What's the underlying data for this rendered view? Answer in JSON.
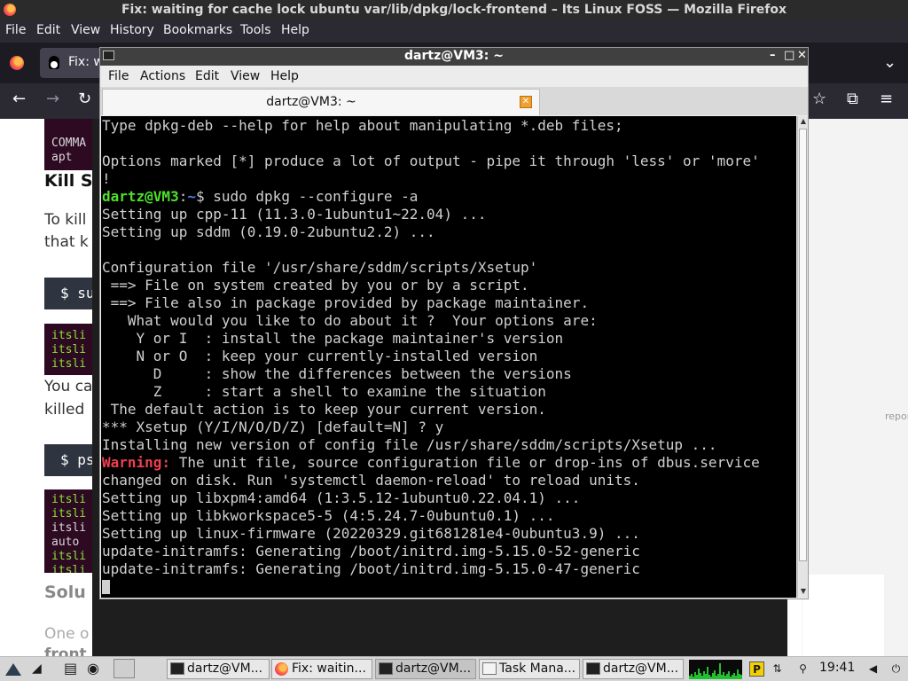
{
  "firefox": {
    "window_title": "Fix: waiting for cache lock ubuntu var/lib/dpkg/lock-frontend – Its Linux FOSS — Mozilla Firefox",
    "menu": [
      "File",
      "Edit",
      "View",
      "History",
      "Bookmarks",
      "Tools",
      "Help"
    ],
    "tab_title": "Fix: w",
    "page": {
      "code1": [
        "COMMA",
        "apt"
      ],
      "heading1": "Kill S",
      "text1a": "To kill",
      "text1b": "that k",
      "cmd1": "$ su",
      "code2": [
        "itsli",
        "itsli",
        "itsli"
      ],
      "text2a": "You ca",
      "text2b": "killed",
      "cmd2": "$ ps",
      "code3": [
        "itsli",
        "itsli",
        "itsli",
        "auto",
        "itsli",
        "itsli"
      ],
      "heading2": "Solu",
      "text3a": "One o",
      "text3b": "front",
      "report": "repor"
    }
  },
  "terminal": {
    "window_title": "dartz@VM3: ~",
    "menu": [
      "File",
      "Actions",
      "Edit",
      "View",
      "Help"
    ],
    "tab_label": "dartz@VM3: ~",
    "lines": {
      "l01": "Type dpkg-deb --help for help about manipulating *.deb files;",
      "l02": "",
      "l03": "Options marked [*] produce a lot of output - pipe it through 'less' or 'more'",
      "l04": "!",
      "prompt_user": "dartz@VM3",
      "prompt_sep": ":",
      "prompt_path": "~",
      "prompt_dollar": "$ ",
      "prompt_cmd": "sudo dpkg --configure -a",
      "l06": "Setting up cpp-11 (11.3.0-1ubuntu1~22.04) ...",
      "l07": "Setting up sddm (0.19.0-2ubuntu2.2) ...",
      "l08": "",
      "l09": "Configuration file '/usr/share/sddm/scripts/Xsetup'",
      "l10": " ==> File on system created by you or by a script.",
      "l11": " ==> File also in package provided by package maintainer.",
      "l12": "   What would you like to do about it ?  Your options are:",
      "l13": "    Y or I  : install the package maintainer's version",
      "l14": "    N or O  : keep your currently-installed version",
      "l15": "      D     : show the differences between the versions",
      "l16": "      Z     : start a shell to examine the situation",
      "l17": " The default action is to keep your current version.",
      "l18": "*** Xsetup (Y/I/N/O/D/Z) [default=N] ? y",
      "l19": "Installing new version of config file /usr/share/sddm/scripts/Xsetup ...",
      "warn_label": "Warning:",
      "warn_rest": " The unit file, source configuration file or drop-ins of dbus.service",
      "l21": "changed on disk. Run 'systemctl daemon-reload' to reload units.",
      "l22": "Setting up libxpm4:amd64 (1:3.5.12-1ubuntu0.22.04.1) ...",
      "l23": "Setting up libkworkspace5-5 (4:5.24.7-0ubuntu0.1) ...",
      "l24": "Setting up linux-firmware (20220329.git681281e4-0ubuntu3.9) ...",
      "l25": "update-initramfs: Generating /boot/initrd.img-5.15.0-52-generic",
      "l26": "update-initramfs: Generating /boot/initrd.img-5.15.0-47-generic"
    }
  },
  "taskbar": {
    "buttons": [
      "dartz@VM...",
      "Fix: waitin...",
      "dartz@VM...",
      "Task Mana...",
      "dartz@VM..."
    ],
    "clock": "19:41"
  },
  "colors": {
    "terminal_bg": "#000000",
    "prompt_user": "#4fe02a",
    "prompt_path": "#4a7ff0",
    "warning": "#ef3f4f",
    "firefox_chrome": "#2b2a33"
  },
  "icons": [
    "firefox-icon",
    "tux-icon",
    "terminal-icon",
    "close-tab-icon",
    "back-icon",
    "forward-icon",
    "reload-icon",
    "bookmark-star-icon",
    "extensions-icon",
    "hamburger-menu-icon",
    "chevron-down-icon",
    "launcher-icon",
    "cpu-graph-icon",
    "clipboard-icon",
    "network-icon",
    "search-icon",
    "volume-icon",
    "power-icon"
  ]
}
